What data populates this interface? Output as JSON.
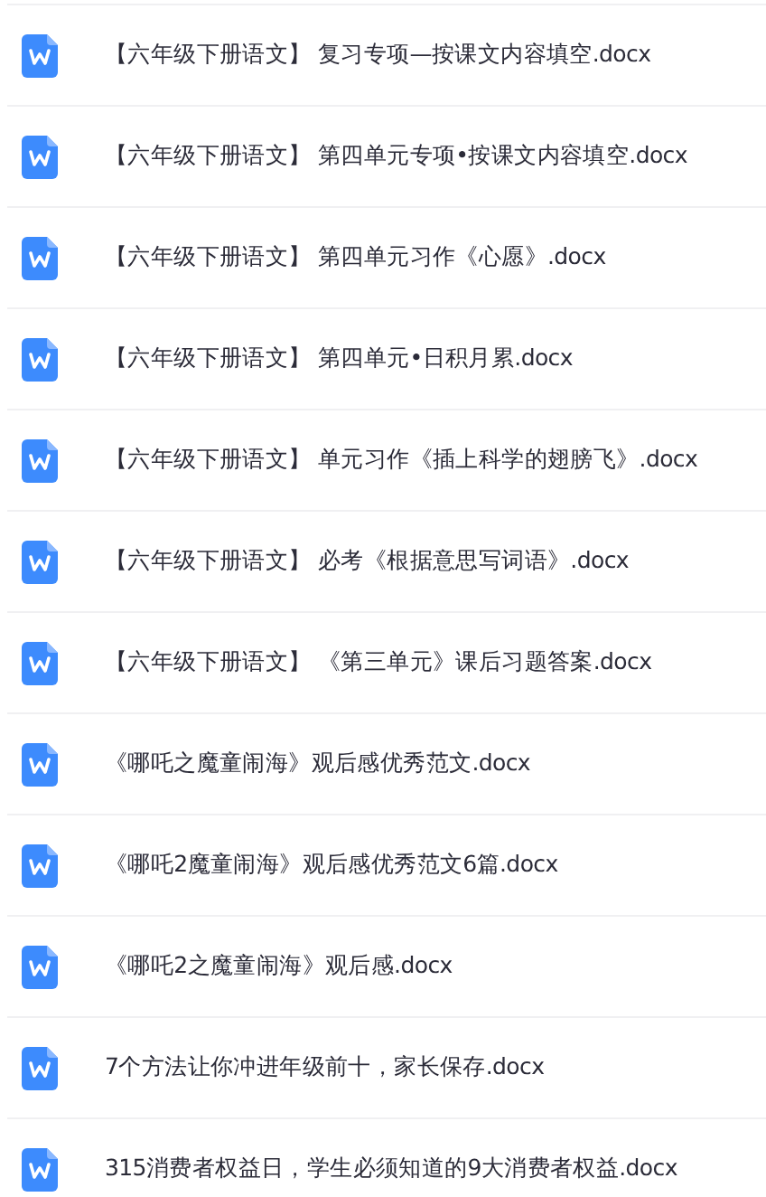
{
  "files": [
    {
      "name": "【六年级下册语文】 复习专项—按课文内容填空.docx"
    },
    {
      "name": "【六年级下册语文】 第四单元专项•按课文内容填空.docx"
    },
    {
      "name": "【六年级下册语文】 第四单元习作《心愿》.docx"
    },
    {
      "name": "【六年级下册语文】 第四单元•日积月累.docx"
    },
    {
      "name": "【六年级下册语文】 单元习作《插上科学的翅膀飞》.docx"
    },
    {
      "name": "【六年级下册语文】 必考《根据意思写词语》.docx"
    },
    {
      "name": "【六年级下册语文】 《第三单元》课后习题答案.docx"
    },
    {
      "name": "《哪吒之魔童闹海》观后感优秀范文.docx"
    },
    {
      "name": "《哪吒2魔童闹海》观后感优秀范文6篇.docx"
    },
    {
      "name": "《哪吒2之魔童闹海》观后感.docx"
    },
    {
      "name": "7个方法让你冲进年级前十，家长保存.docx"
    },
    {
      "name": "315消费者权益日，学生必须知道的9大消费者权益.docx"
    }
  ]
}
